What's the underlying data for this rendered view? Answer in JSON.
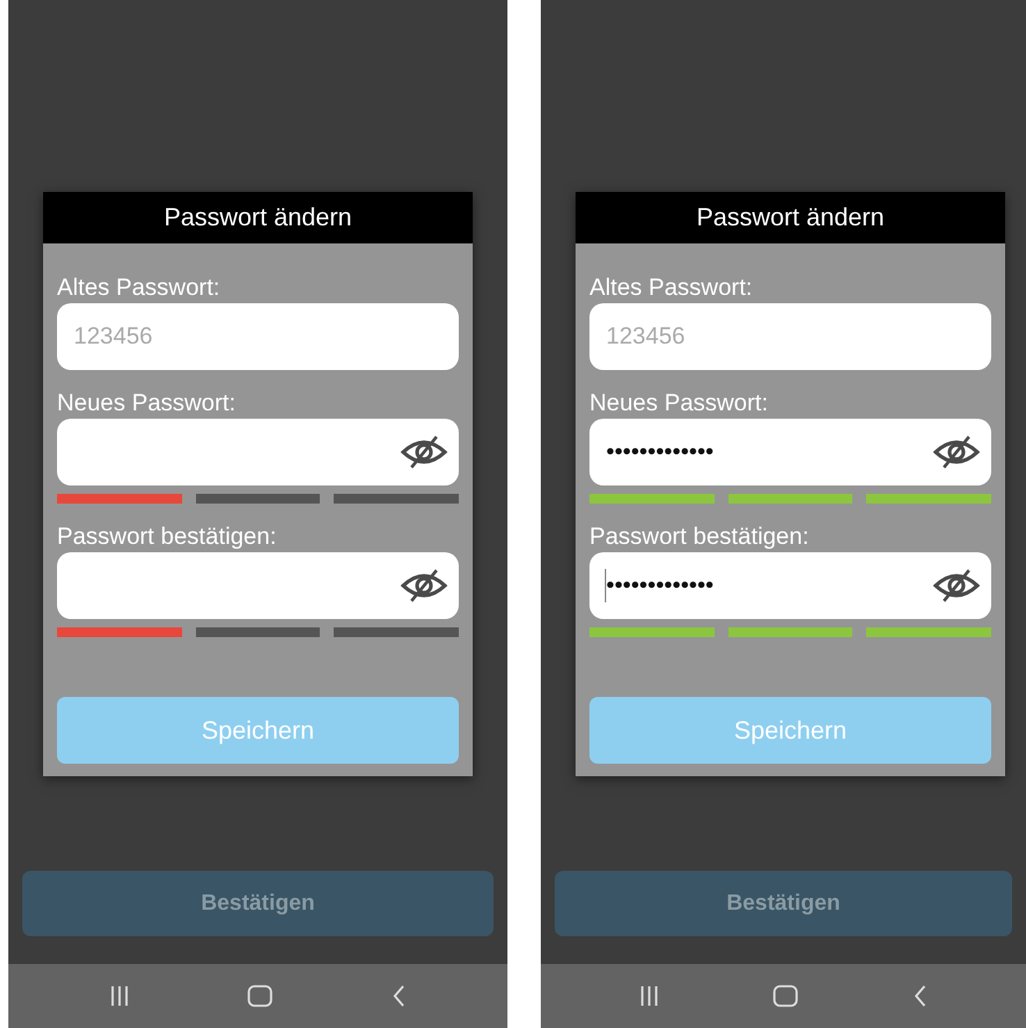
{
  "screens": [
    {
      "dialog": {
        "title": "Passwort ändern",
        "fields": [
          {
            "kind": "plain",
            "label": "Altes Passwort:",
            "placeholder": "123456",
            "focused": false
          },
          {
            "kind": "password",
            "label": "Neues Passwort:",
            "focused": false,
            "strength_segments": [
              {
                "color": "#e8483b"
              },
              {
                "color": "#555555"
              },
              {
                "color": "#555555"
              }
            ]
          },
          {
            "kind": "password",
            "label": "Passwort bestätigen:",
            "focused": false,
            "strength_segments": [
              {
                "color": "#e8483b"
              },
              {
                "color": "#555555"
              },
              {
                "color": "#555555"
              }
            ]
          }
        ],
        "save_button": "Speichern"
      },
      "confirm_button": {
        "label": "Bestätigen",
        "disabled": true
      }
    },
    {
      "dialog": {
        "title": "Passwort ändern",
        "fields": [
          {
            "kind": "plain",
            "label": "Altes Passwort:",
            "placeholder": "123456",
            "focused": false
          },
          {
            "kind": "password",
            "label": "Neues Passwort:",
            "value": "•••••••••••••",
            "focused": false,
            "strength_segments": [
              {
                "color": "#8cc63f"
              },
              {
                "color": "#8cc63f"
              },
              {
                "color": "#8cc63f"
              }
            ]
          },
          {
            "kind": "password",
            "label": "Passwort bestätigen:",
            "value": "•••••••••••••",
            "focused": true,
            "strength_segments": [
              {
                "color": "#8cc63f"
              },
              {
                "color": "#8cc63f"
              },
              {
                "color": "#8cc63f"
              }
            ]
          }
        ],
        "save_button": "Speichern"
      },
      "confirm_button": {
        "label": "Bestätigen",
        "disabled": true
      }
    }
  ]
}
